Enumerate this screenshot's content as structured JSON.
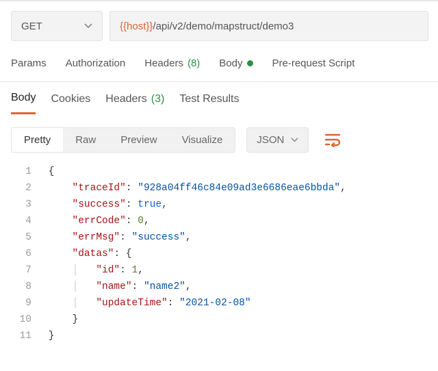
{
  "request": {
    "method": "GET",
    "url_var": "{{host}}",
    "url_path": "/api/v2/demo/mapstruct/demo3"
  },
  "reqTabs": {
    "params": "Params",
    "auth": "Authorization",
    "headers_label": "Headers",
    "headers_count": "(8)",
    "body": "Body",
    "prerequest": "Pre-request Script"
  },
  "respTabs": {
    "body": "Body",
    "cookies": "Cookies",
    "headers_label": "Headers",
    "headers_count": "(3)",
    "tests": "Test Results"
  },
  "viewRow": {
    "pretty": "Pretty",
    "raw": "Raw",
    "preview": "Preview",
    "visualize": "Visualize",
    "format": "JSON"
  },
  "response": {
    "traceId": "928a04ff46c84e09ad3e6686eae6bbda",
    "success": "true",
    "errCode": "0",
    "errMsg": "success",
    "datas": {
      "id": "1",
      "name": "name2",
      "updateTime": "2021-02-08"
    }
  },
  "lineNumbers": [
    "1",
    "2",
    "3",
    "4",
    "5",
    "6",
    "7",
    "8",
    "9",
    "10",
    "11"
  ]
}
